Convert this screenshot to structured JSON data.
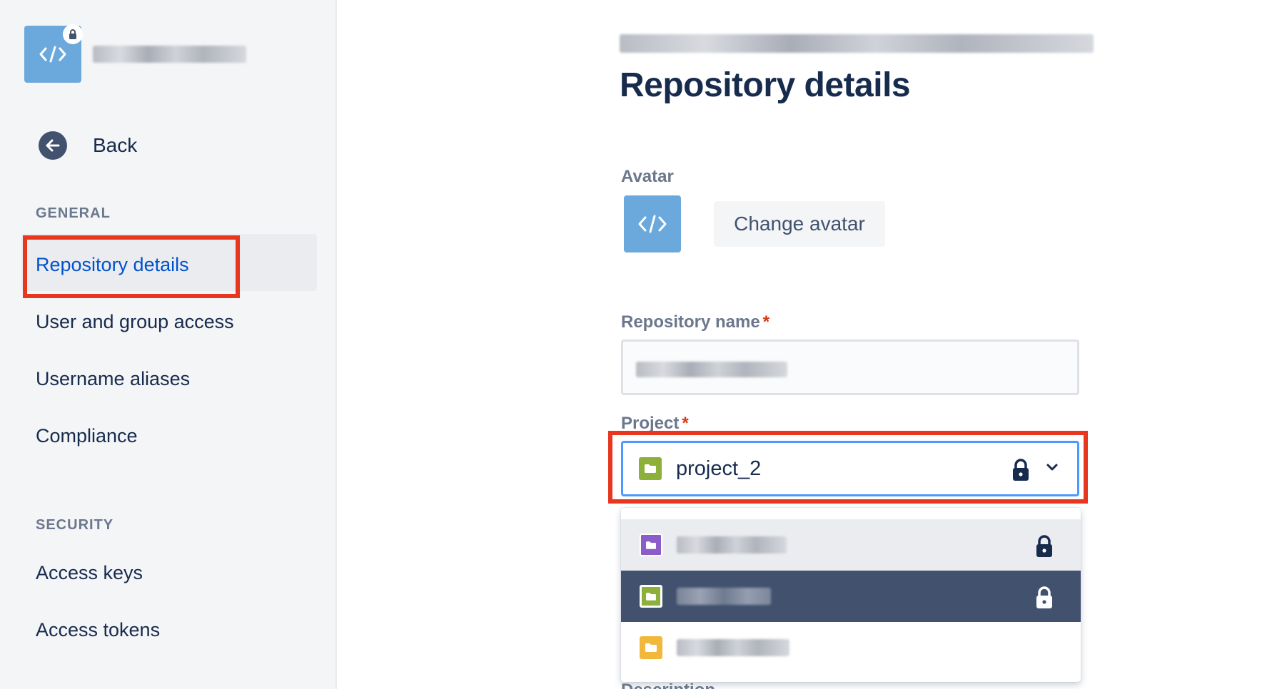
{
  "sidebar": {
    "back_label": "Back",
    "sections": [
      {
        "title": "GENERAL",
        "items": [
          "Repository details",
          "User and group access",
          "Username aliases",
          "Compliance"
        ]
      },
      {
        "title": "SECURITY",
        "items": [
          "Access keys",
          "Access tokens"
        ]
      }
    ],
    "active_item": "Repository details",
    "icons": {
      "repo": "code-icon",
      "lock": "lock-icon",
      "back": "arrow-left-icon"
    }
  },
  "main": {
    "title": "Repository details",
    "avatar_label": "Avatar",
    "change_avatar_label": "Change avatar",
    "repo_name_label": "Repository name",
    "project_label": "Project",
    "required_mark": "*",
    "project_value": "project_2",
    "next_label_partial": "Description"
  },
  "dropdown": {
    "options": [
      {
        "icon_color": "#8c5cc9",
        "state": "hover",
        "locked": true
      },
      {
        "icon_color": "#8db03a",
        "state": "selected",
        "locked": true
      },
      {
        "icon_color": "#f2b83b",
        "state": "normal",
        "locked": false
      }
    ]
  },
  "colors": {
    "accent_blue": "#0052cc",
    "focus_border": "#4c9aff",
    "highlight_red": "#e8361f",
    "selected_option": "#42526e",
    "avatar_blue": "#6ba8dc",
    "project_green": "#8db03a"
  }
}
